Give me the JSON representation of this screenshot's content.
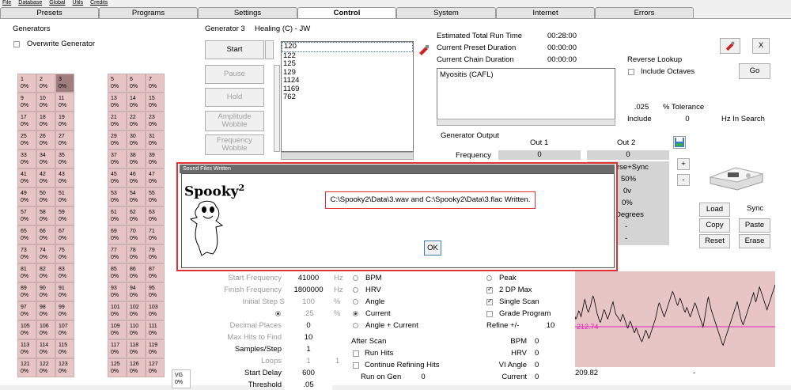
{
  "menu": [
    "File",
    "Database",
    "Global",
    "Utils",
    "Credits"
  ],
  "tabs": [
    "Presets",
    "Programs",
    "Settings",
    "Control",
    "System",
    "Internet",
    "Errors"
  ],
  "active_tab": "Control",
  "generators": {
    "title": "Generators",
    "overwrite_label": "Overwrite Generator",
    "left_cells": [
      [
        "1",
        "0%"
      ],
      [
        "2",
        "0%"
      ],
      [
        "3",
        "0%"
      ],
      [
        "9",
        "0%"
      ],
      [
        "10",
        "0%"
      ],
      [
        "11",
        "0%"
      ],
      [
        "17",
        "0%"
      ],
      [
        "18",
        "0%"
      ],
      [
        "19",
        "0%"
      ],
      [
        "25",
        "0%"
      ],
      [
        "26",
        "0%"
      ],
      [
        "27",
        "0%"
      ],
      [
        "33",
        "0%"
      ],
      [
        "34",
        "0%"
      ],
      [
        "35",
        "0%"
      ],
      [
        "41",
        "0%"
      ],
      [
        "42",
        "0%"
      ],
      [
        "43",
        "0%"
      ],
      [
        "49",
        "0%"
      ],
      [
        "50",
        "0%"
      ],
      [
        "51",
        "0%"
      ],
      [
        "57",
        "0%"
      ],
      [
        "58",
        "0%"
      ],
      [
        "59",
        "0%"
      ],
      [
        "65",
        "0%"
      ],
      [
        "66",
        "0%"
      ],
      [
        "67",
        "0%"
      ],
      [
        "73",
        "0%"
      ],
      [
        "74",
        "0%"
      ],
      [
        "75",
        "0%"
      ],
      [
        "81",
        "0%"
      ],
      [
        "82",
        "0%"
      ],
      [
        "83",
        "0%"
      ],
      [
        "89",
        "0%"
      ],
      [
        "90",
        "0%"
      ],
      [
        "91",
        "0%"
      ],
      [
        "97",
        "0%"
      ],
      [
        "98",
        "0%"
      ],
      [
        "99",
        "0%"
      ],
      [
        "105",
        "0%"
      ],
      [
        "106",
        "0%"
      ],
      [
        "107",
        "0%"
      ],
      [
        "113",
        "0%"
      ],
      [
        "114",
        "0%"
      ],
      [
        "115",
        "0%"
      ],
      [
        "121",
        "0%"
      ],
      [
        "122",
        "0%"
      ],
      [
        "123",
        "0%"
      ]
    ],
    "right_cells": [
      [
        "5",
        "0%"
      ],
      [
        "6",
        "0%"
      ],
      [
        "7",
        "0%"
      ],
      [
        "13",
        "0%"
      ],
      [
        "14",
        "0%"
      ],
      [
        "15",
        "0%"
      ],
      [
        "21",
        "0%"
      ],
      [
        "22",
        "0%"
      ],
      [
        "23",
        "0%"
      ],
      [
        "29",
        "0%"
      ],
      [
        "30",
        "0%"
      ],
      [
        "31",
        "0%"
      ],
      [
        "37",
        "0%"
      ],
      [
        "38",
        "0%"
      ],
      [
        "39",
        "0%"
      ],
      [
        "45",
        "0%"
      ],
      [
        "46",
        "0%"
      ],
      [
        "47",
        "0%"
      ],
      [
        "53",
        "0%"
      ],
      [
        "54",
        "0%"
      ],
      [
        "55",
        "0%"
      ],
      [
        "61",
        "0%"
      ],
      [
        "62",
        "0%"
      ],
      [
        "63",
        "0%"
      ],
      [
        "69",
        "0%"
      ],
      [
        "70",
        "0%"
      ],
      [
        "71",
        "0%"
      ],
      [
        "77",
        "0%"
      ],
      [
        "78",
        "0%"
      ],
      [
        "79",
        "0%"
      ],
      [
        "85",
        "0%"
      ],
      [
        "86",
        "0%"
      ],
      [
        "87",
        "0%"
      ],
      [
        "93",
        "0%"
      ],
      [
        "94",
        "0%"
      ],
      [
        "95",
        "0%"
      ],
      [
        "101",
        "0%"
      ],
      [
        "102",
        "0%"
      ],
      [
        "103",
        "0%"
      ],
      [
        "109",
        "0%"
      ],
      [
        "110",
        "0%"
      ],
      [
        "111",
        "0%"
      ],
      [
        "117",
        "0%"
      ],
      [
        "118",
        "0%"
      ],
      [
        "119",
        "0%"
      ],
      [
        "125",
        "0%"
      ],
      [
        "126",
        "0%"
      ],
      [
        "127",
        "0%"
      ]
    ],
    "vg_label": "VG",
    "vg_value": "0%"
  },
  "control": {
    "generator_label": "Generator 3",
    "program_label": "Healing (C) - JW",
    "start": "Start",
    "pause": "Pause",
    "hold": "Hold",
    "amplitude_wobble": "Amplitude Wobble",
    "frequency_wobble": "Frequency Wobble",
    "freq_list": [
      "120",
      "122",
      "125",
      "129",
      "1124",
      "1169",
      "762"
    ]
  },
  "runtime": {
    "total_label": "Estimated Total Run Time",
    "total": "00:28:00",
    "preset_label": "Current Preset Duration",
    "preset": "00:00:00",
    "chain_label": "Current Chain Duration",
    "chain": "00:00:00",
    "program_entry": "Myositis (CAFL)"
  },
  "reverse": {
    "title": "Reverse Lookup",
    "include_octaves": "Include Octaves",
    "go": "Go",
    "tolerance_value": ".025",
    "tolerance_label": "% Tolerance",
    "include_label": "Include",
    "include_value": "0",
    "hz_label": "Hz In Search"
  },
  "output": {
    "title": "Generator Output",
    "out1": "Out 1",
    "out2": "Out 2",
    "frequency_label": "Frequency",
    "freq1": "0",
    "freq2": "0",
    "inverse_sync": "rse+Sync",
    "pct": "50%",
    "ov": "0v",
    "zero_pct": "0%",
    "degrees": "Degrees",
    "dash1": "-",
    "dash2": "-"
  },
  "device": {
    "plus": "+",
    "minus": "-",
    "load": "Load",
    "copy": "Copy",
    "reset": "Reset",
    "sync": "Sync",
    "paste": "Paste",
    "erase": "Erase",
    "close": "X"
  },
  "dialog": {
    "title": "Sound Files Written",
    "logo": "Spooky",
    "logo_sup": "2",
    "message": "C:\\Spooky2\\Data\\3.wav and C:\\Spooky2\\Data\\3.flac Written.",
    "ok": "OK"
  },
  "scan": {
    "start_freq_label": "Start Frequency",
    "start_freq": "41000",
    "hz1": "Hz",
    "finish_freq_label": "Finish Frequency",
    "finish_freq": "1800000",
    "hz2": "Hz",
    "initial_step_label": "Initial Step Size",
    "initial_step": "100",
    "pct_unit": "%",
    "step2": ".25",
    "pct2": "%",
    "decimal_label": "Decimal Places",
    "decimal": "0",
    "maxhits_label": "Max Hits to Find",
    "maxhits": "10",
    "samples_label": "Samples/Step",
    "samples": "1",
    "loops_label": "Loops",
    "loops": "1",
    "loops2": "1",
    "delay_label": "Start Delay",
    "delay": "600",
    "threshold_label": "Threshold",
    "threshold": ".05",
    "modes": [
      "BPM",
      "HRV",
      "Angle",
      "Current",
      "Angle + Current"
    ],
    "selected_mode": "Current",
    "after_scan": "After Scan",
    "run_hits": "Run Hits",
    "continue_refining": "Continue Refining Hits",
    "run_on_gen": "Run on Gen",
    "run_on_gen_value": "0",
    "peak": "Peak",
    "dp_max": "2 DP Max",
    "single_scan": "Single Scan",
    "grade": "Grade Program",
    "refine_label": "Refine +/-",
    "refine": "10",
    "bpm": "BPM",
    "bpm_v": "0",
    "hrv": "HRV",
    "hrv_v": "0",
    "vi_angle": "VI Angle",
    "vi_v": "0",
    "current": "Current",
    "current_v": "0"
  },
  "graph": {
    "marker": "212.74",
    "bottom_left": "209.82",
    "bottom_mid": "-",
    "line_color": "#000000",
    "marker_color": "#e020c0",
    "bg_color": "#e8c5c5",
    "points": [
      40,
      38,
      39,
      41,
      43,
      45,
      44,
      42,
      40,
      43,
      46,
      49,
      52,
      55,
      53,
      50,
      47,
      45,
      44,
      46,
      48,
      50,
      53,
      56,
      58,
      57,
      54,
      51,
      48,
      45,
      42,
      40,
      38,
      36,
      35,
      37,
      39,
      42,
      44,
      46,
      45,
      43,
      41,
      39,
      38,
      40,
      42,
      44,
      47,
      49,
      51,
      53,
      50,
      47,
      44,
      42,
      41,
      40,
      39,
      38,
      37,
      36,
      38,
      40,
      42,
      41,
      39,
      37,
      35,
      33,
      31,
      30,
      32,
      34,
      36,
      35,
      33,
      31,
      29,
      27,
      26,
      28,
      30,
      29,
      27,
      25,
      24,
      22,
      20,
      19,
      18,
      20,
      22,
      24,
      26,
      28,
      27,
      25,
      23,
      21,
      22,
      24,
      26,
      28,
      30,
      32,
      34,
      36,
      38,
      41,
      44,
      47,
      50,
      52,
      51,
      49,
      47,
      45,
      43,
      41,
      40,
      42,
      44,
      46,
      48,
      50,
      52,
      54,
      56,
      58,
      60,
      62,
      61,
      59,
      57,
      55,
      53,
      51,
      50,
      52,
      54,
      56,
      55,
      53,
      51,
      49,
      47,
      45,
      44,
      46,
      48,
      47,
      45,
      43,
      41,
      40,
      42,
      44,
      46,
      48,
      50,
      52,
      51,
      49,
      47,
      45,
      43,
      41,
      39,
      37,
      35,
      33,
      31,
      34,
      38,
      42,
      46,
      50,
      54,
      57,
      55,
      52,
      49,
      46,
      44,
      42,
      40,
      38,
      36,
      34,
      32,
      30,
      28,
      26,
      24,
      22,
      20,
      18,
      16,
      15,
      17,
      19,
      21,
      23,
      25,
      27,
      29,
      31,
      33,
      35,
      37,
      39,
      41,
      43,
      45,
      47,
      49,
      51,
      53,
      50,
      47,
      44,
      41,
      38,
      36,
      34,
      33,
      35,
      37,
      39,
      41,
      43,
      45,
      47,
      49,
      51,
      53,
      55,
      57,
      59,
      61,
      58,
      55,
      53,
      55,
      58,
      61,
      64,
      66,
      64,
      62,
      60,
      58,
      56,
      54,
      52,
      50,
      48,
      46,
      48,
      50,
      52,
      54,
      56,
      58,
      60,
      62,
      64,
      66,
      68
    ]
  }
}
